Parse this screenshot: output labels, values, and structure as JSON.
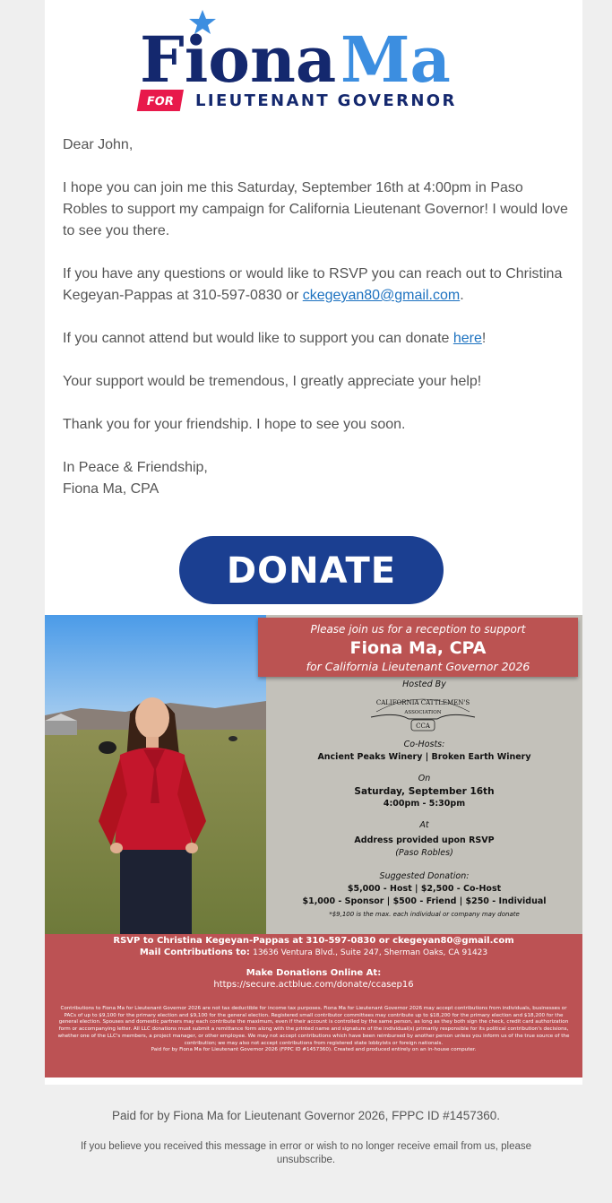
{
  "logo": {
    "first": "Fiona",
    "last": "Ma",
    "for": "FOR",
    "office": "LIEUTENANT GOVERNOR",
    "navy": "#14286e",
    "blue": "#3c8ee0",
    "red": "#e8194b"
  },
  "letter": {
    "greeting": "Dear John,",
    "p1": "I hope you can join me this Saturday, September 16th at 4:00pm in Paso Robles to support my campaign for California Lieutenant Governor! I would love to see you there.",
    "p2_pre": "If you have any questions or would like to RSVP you can reach out to Christina Kegeyan-Pappas at 310-597-0830 or ",
    "p2_link": "ckegeyan80@gmail.com",
    "p2_post": ".",
    "p3_pre": "If you cannot attend but would like to support you can donate ",
    "p3_link": "here",
    "p3_post": "!",
    "p4": "Your support would be tremendous, I greatly appreciate your help!",
    "p5": "Thank you for your friendship. I hope to see you soon.",
    "closing": "In Peace & Friendship,",
    "signature": "Fiona Ma, CPA"
  },
  "donate_button": "DONATE",
  "flyer": {
    "invite": "Please join us for a reception to support",
    "name": "Fiona Ma, CPA",
    "for_office": "for California Lieutenant Governor 2026",
    "hosted_by": "Hosted By",
    "host_org": "CALIFORNIA CATTLEMEN'S",
    "host_org_sub": "ASSOCIATION",
    "host_abbr": "CCA",
    "cohosts_label": "Co-Hosts:",
    "cohosts": "Ancient Peaks Winery | Broken Earth Winery",
    "on_label": "On",
    "date": "Saturday, September 16th",
    "time": "4:00pm - 5:30pm",
    "at_label": "At",
    "address": "Address provided upon RSVP",
    "city": "(Paso Robles)",
    "suggested_label": "Suggested Donation:",
    "tier1": "$5,000 - Host  |  $2,500 - Co-Host",
    "tier2": "$1,000 - Sponsor  |  $500 - Friend  |  $250 - Individual",
    "max_note": "*$9,100 is the max. each individual or company may donate",
    "rsvp": "RSVP to Christina Kegeyan-Pappas at 310-597-0830 or ckegeyan80@gmail.com",
    "mail_label": "Mail Contributions to:",
    "mail_address": "13636 Ventura Blvd., Suite 247, Sherman Oaks, CA 91423",
    "online_label": "Make Donations Online At:",
    "online_url": "https://secure.actblue.com/donate/ccasep16",
    "fine_print": "Contributions to Fiona Ma for Lieutenant Governor 2026 are not tax deductible for income tax purposes. Fiona Ma for Lieutenant Governor 2026 may accept contributions from individuals, businesses or PACs of up to $9,100 for the primary election and $9,100 for the general election. Registered small contributor committees may contribute up to $18,200 for the primary election and $18,200 for the general election. Spouses and domestic partners may each contribute the maximum, even if their account is controlled by the same person, as long as they both sign the check, credit card authorization form or accompanying letter. All LLC donations must submit a remittance form along with the printed name and signature of the individual(s) primarily responsible for its political contribution's decisions, whether one of the LLC's members, a project manager, or other employee. We may not accept contributions which have been reimbursed by another person unless you inform us of the true source of the contribution; we may also not accept contributions from registered state lobbyists or foreign nationals.",
    "fine_paid": "Paid for by Fiona Ma for Lieutenant Governor 2026 (FPPC ID #1457360). Created and produced entirely on an in-house computer.",
    "banner_color": "#bb5352"
  },
  "footer": {
    "paid_for": "Paid for by Fiona Ma for Lieutenant Governor 2026, FPPC ID #1457360.",
    "unsub_pre": "If you believe you received this message in error or wish to no longer receive email from us, please ",
    "unsub_link": "unsubscribe",
    "unsub_post": "."
  }
}
